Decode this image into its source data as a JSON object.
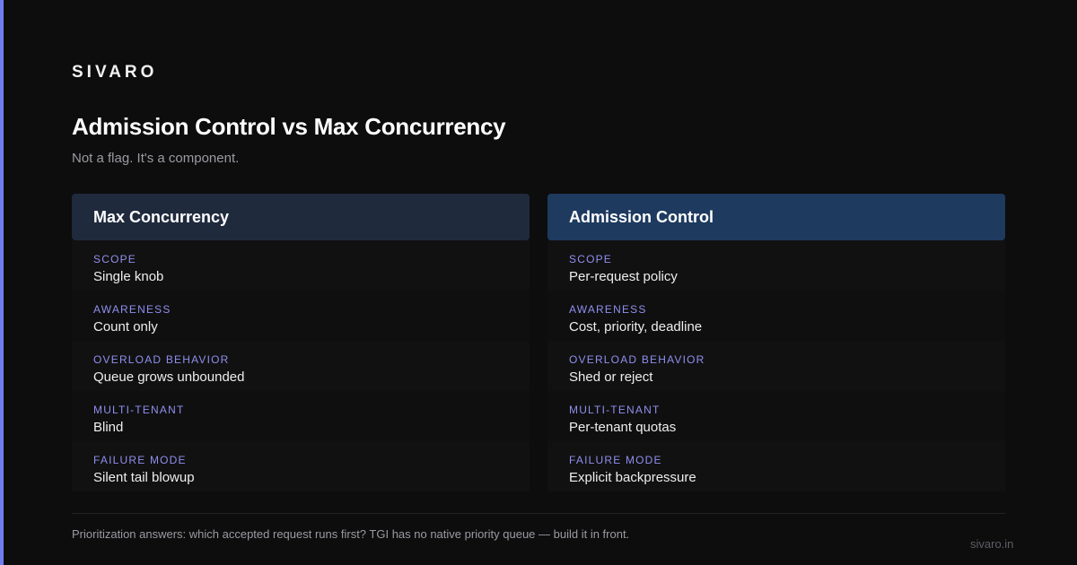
{
  "brand": "SIVARO",
  "title": "Admission Control vs Max Concurrency",
  "subtitle": "Not a flag. It's a component.",
  "colors": {
    "accent_bar": "#6f7df0",
    "background": "#0d0d0d",
    "left_header": "#1f2a3d",
    "right_header": "#1e3a5f",
    "label": "#8f8ff0"
  },
  "left_card": {
    "header": "Max Concurrency",
    "rows": [
      {
        "label": "SCOPE",
        "value": "Single knob"
      },
      {
        "label": "AWARENESS",
        "value": "Count only"
      },
      {
        "label": "OVERLOAD BEHAVIOR",
        "value": "Queue grows unbounded"
      },
      {
        "label": "MULTI-TENANT",
        "value": "Blind"
      },
      {
        "label": "FAILURE MODE",
        "value": "Silent tail blowup"
      }
    ]
  },
  "right_card": {
    "header": "Admission Control",
    "rows": [
      {
        "label": "SCOPE",
        "value": "Per-request policy"
      },
      {
        "label": "AWARENESS",
        "value": "Cost, priority, deadline"
      },
      {
        "label": "OVERLOAD BEHAVIOR",
        "value": "Shed or reject"
      },
      {
        "label": "MULTI-TENANT",
        "value": "Per-tenant quotas"
      },
      {
        "label": "FAILURE MODE",
        "value": "Explicit backpressure"
      }
    ]
  },
  "footer_note": "Prioritization answers: which accepted request runs first? TGI has no native priority queue — build it in front.",
  "site": "sivaro.in"
}
